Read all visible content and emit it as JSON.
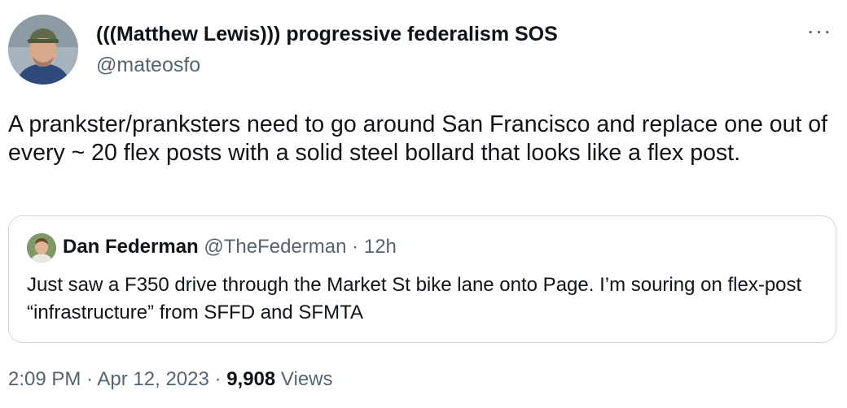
{
  "author": {
    "display_name": "(((Matthew Lewis))) progressive federalism SOS",
    "handle": "@mateosfo",
    "more_icon": "more-horizontal-icon"
  },
  "tweet": {
    "text": "A prankster/pranksters need to go around San Francisco and replace one out of every ~ 20 flex posts with a solid steel bollard that looks like a flex post."
  },
  "quote": {
    "display_name": "Dan Federman",
    "handle": "@TheFederman",
    "separator": "·",
    "age": "12h",
    "text": "Just saw a F350 drive through the Market St bike lane onto Page. I’m souring on flex-post “infrastructure” from SFFD and SFMTA"
  },
  "meta": {
    "time": "2:09 PM",
    "separator": "·",
    "date": "Apr 12, 2023",
    "views_count": "9,908",
    "views_label": "Views"
  },
  "colors": {
    "text": "#0f1419",
    "secondary": "#536471",
    "border": "#cfd9de"
  }
}
